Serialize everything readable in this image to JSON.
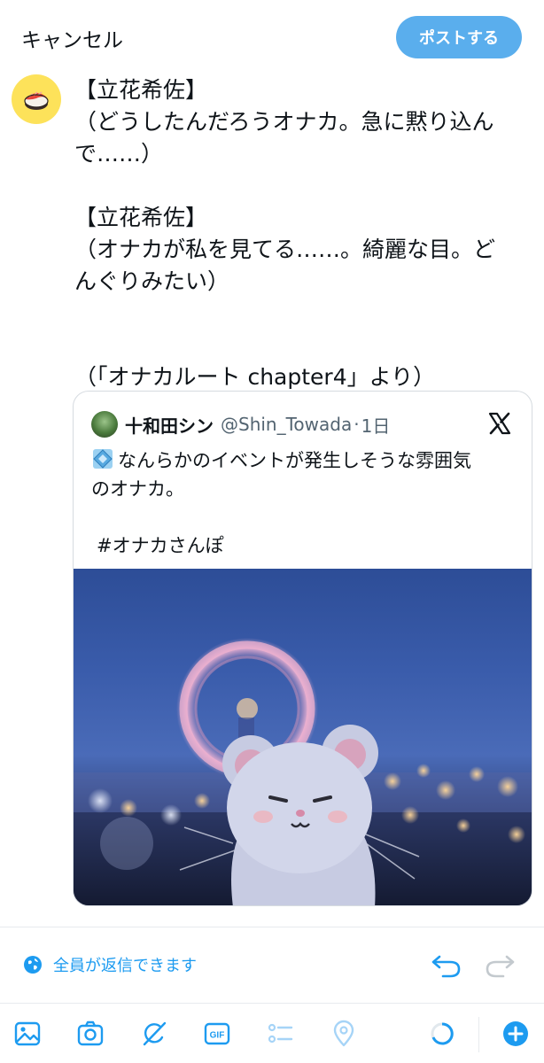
{
  "header": {
    "cancel_label": "キャンセル",
    "post_label": "ポストする"
  },
  "compose": {
    "avatar_icon": "sushi-icon",
    "lines": [
      "【立花希佐】",
      "（どうしたんだろうオナカ。急に黙り込ん",
      "で……）",
      "【立花希佐】",
      "（オナカが私を見てる……。綺麗な目。ど",
      "んぐりみたい）",
      "（「オナカルート chapter4」より）"
    ]
  },
  "quote": {
    "name": "十和田シン",
    "handle": "@Shin_Towada",
    "separator": "·",
    "time": "1日",
    "platform_icon": "x-logo-icon",
    "text_line1": "なんらかのイベントが発生しそうな雰囲気",
    "text_line2": "のオナカ。",
    "hashtag": "#オナカさんぽ",
    "image_icon": "plush-mouse-ferris-wheel-photo"
  },
  "reply": {
    "setting_label": "全員が返信できます"
  },
  "toolbar": {
    "icons": [
      "image-icon",
      "camera-icon",
      "grok-icon",
      "gif-icon",
      "poll-icon",
      "location-icon",
      "char-count-ring-icon",
      "add-post-icon"
    ]
  },
  "colors": {
    "accent": "#1d9bf0",
    "post_button": "#5aaeed",
    "avatar_bg": "#fde25a",
    "text": "#0f1419",
    "muted": "#536471"
  }
}
